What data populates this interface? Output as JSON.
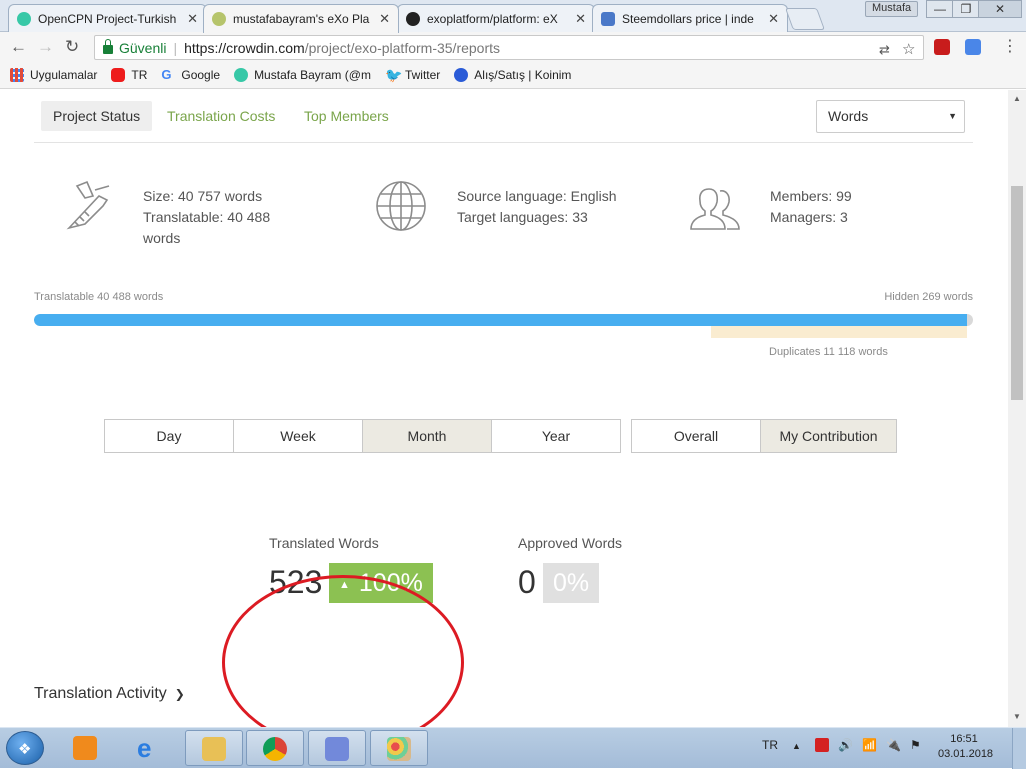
{
  "browser": {
    "tabs": [
      {
        "title": "OpenCPN Project-Turkish",
        "active": false,
        "favicon_color": "#37c8a7"
      },
      {
        "title": "mustafabayram's eXo Pla",
        "active": true,
        "favicon_color": "#b6c46b"
      },
      {
        "title": "exoplatform/platform: eX",
        "active": false,
        "favicon_color": "#222222"
      },
      {
        "title": "Steemdollars price | inde",
        "active": false,
        "favicon_color": "#4a78c8"
      }
    ],
    "profile_name": "Mustafa",
    "security_label": "Güvenli",
    "url_host": "https://crowdin.com",
    "url_path": "/project/exo-platform-35/reports",
    "bookmarks": [
      {
        "label": "Uygulamalar",
        "icon": "apps-grid-icon",
        "color": "#e04a3a"
      },
      {
        "label": "TR",
        "icon": "youtube-icon",
        "color": "#ee1c1c"
      },
      {
        "label": "Google",
        "icon": "google-icon",
        "color": "#4285f4"
      },
      {
        "label": "Mustafa Bayram (@m",
        "icon": "steemit-icon",
        "color": "#37c8a7"
      },
      {
        "label": "Twitter",
        "icon": "twitter-icon",
        "color": "#1da1f2"
      },
      {
        "label": "Alış/Satış | Koinim",
        "icon": "koinim-icon",
        "color": "#2a5bd7"
      }
    ]
  },
  "subnav": {
    "tabs": [
      {
        "label": "Project Status",
        "active": true
      },
      {
        "label": "Translation Costs",
        "active": false
      },
      {
        "label": "Top Members",
        "active": false
      }
    ],
    "unit_select": "Words"
  },
  "stats": {
    "size_line": "Size: 40 757 words",
    "translatable_line1": "Translatable: 40 488",
    "translatable_line2": "words",
    "source_language": "Source language: English",
    "target_languages": "Target languages: 33",
    "members": "Members: 99",
    "managers": "Managers: 3"
  },
  "progress": {
    "left_label": "Translatable 40 488 words",
    "right_label": "Hidden 269 words",
    "duplicates_label": "Duplicates 11 118 words",
    "translatable_fraction": 0.9934,
    "duplicates_fraction": 0.2728
  },
  "periods": [
    {
      "label": "Day",
      "selected": false
    },
    {
      "label": "Week",
      "selected": false
    },
    {
      "label": "Month",
      "selected": true
    },
    {
      "label": "Year",
      "selected": false
    }
  ],
  "scopes": [
    {
      "label": "Overall",
      "selected": false
    },
    {
      "label": "My Contribution",
      "selected": true
    }
  ],
  "metrics": {
    "translated": {
      "label": "Translated Words",
      "value": "523",
      "delta": "100%"
    },
    "approved": {
      "label": "Approved Words",
      "value": "0",
      "delta": "0%"
    }
  },
  "activity_heading": "Translation Activity",
  "taskbar": {
    "language": "TR",
    "time": "16:51",
    "date": "03.01.2018"
  },
  "colors": {
    "accent_green": "#8cc152",
    "progress_blue": "#47aef0",
    "link_green": "#7aa54b",
    "annotation_red": "#dc1b23"
  }
}
